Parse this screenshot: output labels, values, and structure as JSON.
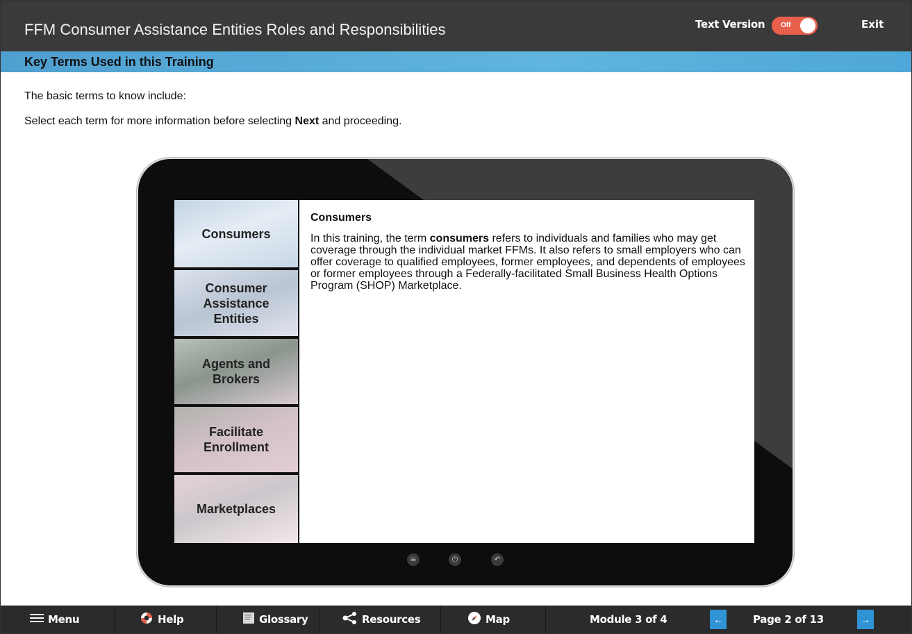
{
  "header": {
    "title": "FFM Consumer Assistance Entities Roles and Responsibilities",
    "text_version_label": "Text Version",
    "toggle_state": "Off",
    "exit_label": "Exit"
  },
  "section": {
    "title": "Key Terms Used in this Training"
  },
  "intro": {
    "line1": "The basic terms to know include:",
    "line2_before": "Select each term for more information before selecting ",
    "line2_bold": "Next",
    "line2_after": " and proceeding."
  },
  "terms": [
    {
      "label": "Consumers"
    },
    {
      "label": "Consumer Assistance Entities"
    },
    {
      "label": "Agents and Brokers"
    },
    {
      "label": "Facilitate Enrollment"
    },
    {
      "label": "Marketplaces"
    }
  ],
  "content": {
    "heading": "Consumers",
    "body_before": "In this training, the term ",
    "body_bold": "consumers",
    "body_after": " refers to individuals and families who may get coverage through the individual market FFMs. It also refers to small employers who can offer coverage to qualified employees, former employees, and dependents of employees or former employees through a Federally-facilitated Small Business Health Options Program (SHOP) Marketplace."
  },
  "footer": {
    "menu_label": "Menu",
    "help_label": "Help",
    "glossary_label": "Glossary",
    "resources_label": "Resources",
    "map_label": "Map",
    "module_label": "Module 3 of 4",
    "page_label": "Page 2 of 13",
    "prev_icon": "←",
    "next_icon": "→"
  },
  "colors": {
    "top_bar": "#3a3a3a",
    "section_header": "#5fb5dd",
    "toggle": "#e8604c",
    "nav_arrow": "#2f93d6",
    "bottom_bar": "#2b2b2b"
  }
}
